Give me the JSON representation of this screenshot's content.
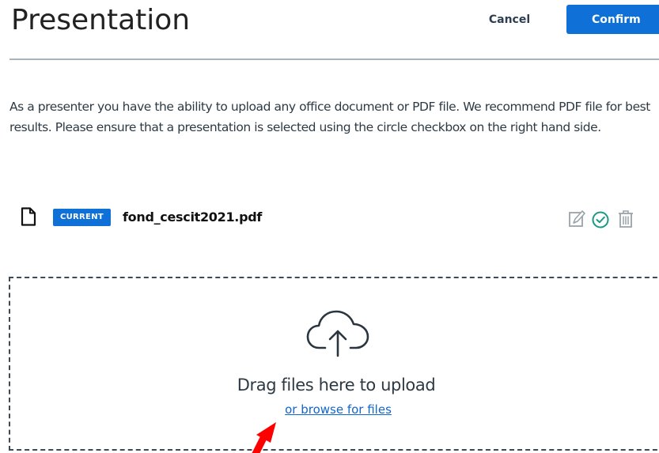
{
  "header": {
    "title": "Presentation",
    "cancel_label": "Cancel",
    "confirm_label": "Confirm"
  },
  "description": "As a presenter you have the ability to upload any office document or PDF file. We recommend PDF file for best results. Please ensure that a presentation is selected using the circle checkbox on the right hand side.",
  "files": [
    {
      "badge": "CURRENT",
      "name": "fond_cescit2021.pdf",
      "icon": "document-icon",
      "actions": [
        "edit-icon",
        "check-circle-icon",
        "trash-icon"
      ]
    }
  ],
  "dropzone": {
    "icon": "cloud-upload-icon",
    "text": "Drag files here to upload",
    "browse_label": "or browse for files"
  },
  "colors": {
    "accent": "#0f70d7",
    "link": "#1166cc",
    "check": "#1a9a82",
    "annotation_arrow": "#ff0000"
  }
}
